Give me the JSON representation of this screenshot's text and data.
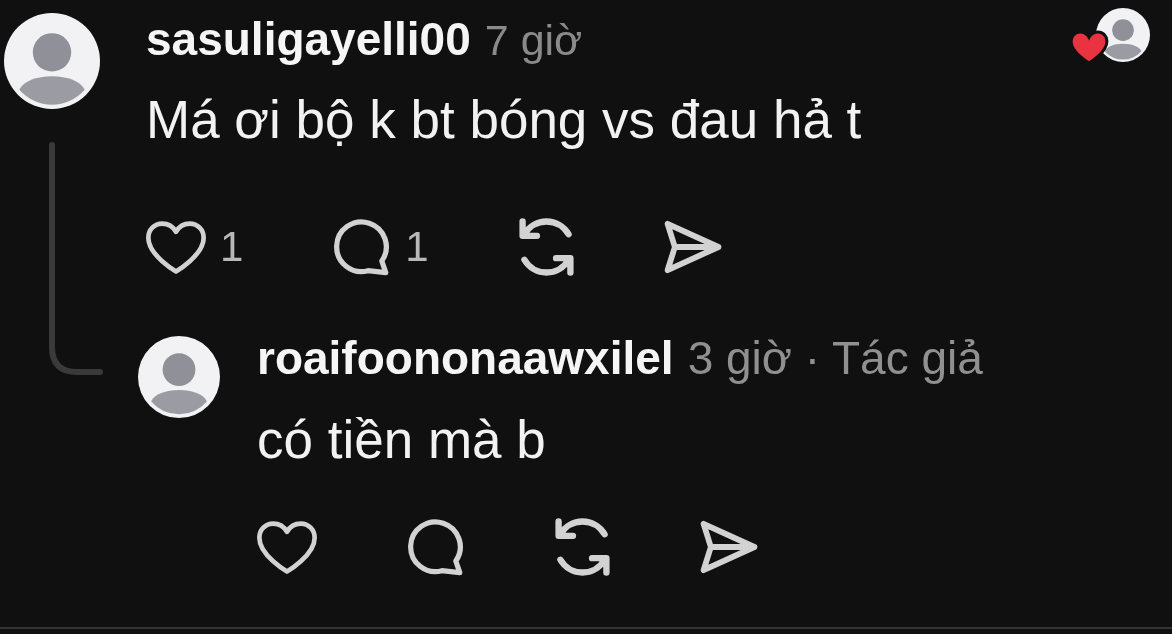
{
  "comments": [
    {
      "username": "sasuligayelli00",
      "meta": "7 giờ",
      "creator_liked": true,
      "text": "Má ơi bộ k bt bóng vs đau hả t",
      "actions": [
        {
          "kind": "like",
          "count": "1"
        },
        {
          "kind": "reply",
          "count": "1"
        },
        {
          "kind": "repost"
        },
        {
          "kind": "share"
        }
      ],
      "replies": [
        {
          "username": "roaifoononaawxilel",
          "meta": "3 giờ · Tác giả",
          "text": "có tiền mà b",
          "actions": [
            {
              "kind": "like"
            },
            {
              "kind": "reply"
            },
            {
              "kind": "repost"
            },
            {
              "kind": "share"
            }
          ]
        }
      ]
    }
  ]
}
